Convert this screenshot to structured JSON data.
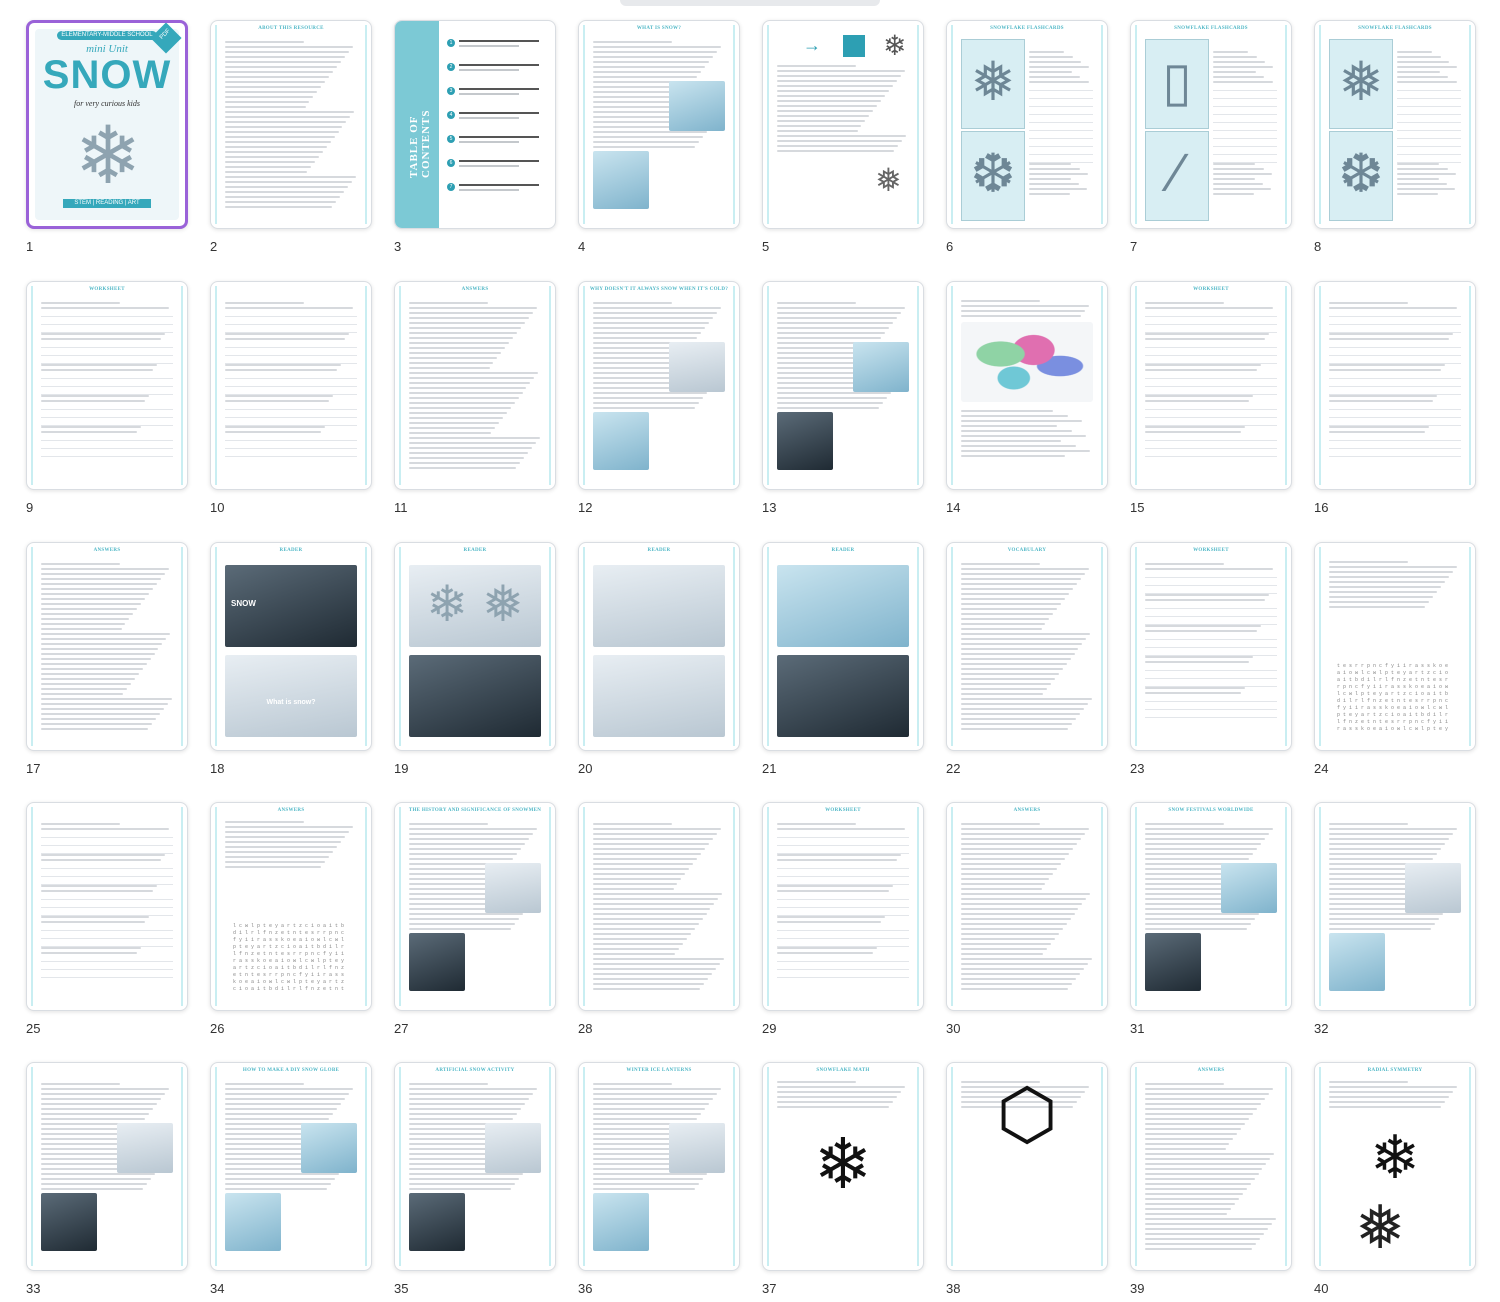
{
  "pages": [
    {
      "n": "1",
      "kind": "cover"
    },
    {
      "n": "2",
      "kind": "text",
      "title": "ABOUT THIS RESOURCE"
    },
    {
      "n": "3",
      "kind": "toc"
    },
    {
      "n": "4",
      "kind": "text-img",
      "title": "WHAT IS SNOW?"
    },
    {
      "n": "5",
      "kind": "diagram",
      "title": ""
    },
    {
      "n": "6",
      "kind": "flash",
      "title": "SNOWFLAKE FLASHCARDS"
    },
    {
      "n": "7",
      "kind": "flash",
      "title": "SNOWFLAKE FLASHCARDS"
    },
    {
      "n": "8",
      "kind": "flash",
      "title": "SNOWFLAKE FLASHCARDS"
    },
    {
      "n": "9",
      "kind": "worksheet",
      "title": "WORKSHEET"
    },
    {
      "n": "10",
      "kind": "worksheet",
      "title": ""
    },
    {
      "n": "11",
      "kind": "text",
      "title": "ANSWERS"
    },
    {
      "n": "12",
      "kind": "text-img",
      "title": "WHY DOESN'T IT ALWAYS SNOW WHEN IT'S COLD?"
    },
    {
      "n": "13",
      "kind": "text-img",
      "title": ""
    },
    {
      "n": "14",
      "kind": "map",
      "title": ""
    },
    {
      "n": "15",
      "kind": "worksheet",
      "title": "WORKSHEET"
    },
    {
      "n": "16",
      "kind": "worksheet",
      "title": ""
    },
    {
      "n": "17",
      "kind": "text",
      "title": "ANSWERS"
    },
    {
      "n": "18",
      "kind": "reader",
      "title": "READER"
    },
    {
      "n": "19",
      "kind": "reader",
      "title": "READER"
    },
    {
      "n": "20",
      "kind": "reader",
      "title": "READER"
    },
    {
      "n": "21",
      "kind": "reader",
      "title": "READER"
    },
    {
      "n": "22",
      "kind": "text",
      "title": "VOCABULARY"
    },
    {
      "n": "23",
      "kind": "worksheet",
      "title": "WORKSHEET"
    },
    {
      "n": "24",
      "kind": "wordsearch",
      "title": ""
    },
    {
      "n": "25",
      "kind": "worksheet",
      "title": ""
    },
    {
      "n": "26",
      "kind": "wordsearch",
      "title": "ANSWERS"
    },
    {
      "n": "27",
      "kind": "text-img",
      "title": "THE HISTORY AND SIGNIFICANCE OF SNOWMEN"
    },
    {
      "n": "28",
      "kind": "text",
      "title": ""
    },
    {
      "n": "29",
      "kind": "worksheet",
      "title": "WORKSHEET"
    },
    {
      "n": "30",
      "kind": "text",
      "title": "ANSWERS"
    },
    {
      "n": "31",
      "kind": "text-img",
      "title": "SNOW FESTIVALS WORLDWIDE"
    },
    {
      "n": "32",
      "kind": "text-img",
      "title": ""
    },
    {
      "n": "33",
      "kind": "text-img",
      "title": ""
    },
    {
      "n": "34",
      "kind": "text-img",
      "title": "HOW TO MAKE A DIY SNOW GLOBE"
    },
    {
      "n": "35",
      "kind": "text-img",
      "title": "ARTIFICIAL SNOW ACTIVITY"
    },
    {
      "n": "36",
      "kind": "text-img",
      "title": "WINTER ICE LANTERNS"
    },
    {
      "n": "37",
      "kind": "math",
      "title": "SNOWFLAKE MATH"
    },
    {
      "n": "38",
      "kind": "math",
      "title": ""
    },
    {
      "n": "39",
      "kind": "text",
      "title": "ANSWERS"
    },
    {
      "n": "40",
      "kind": "math",
      "title": "RADIAL SYMMETRY"
    }
  ],
  "cover": {
    "school": "ELEMENTARY-MIDDLE SCHOOL",
    "unit": "mini Unit",
    "title": "SNOW",
    "subtitle": "for very curious kids",
    "badge": "PDF",
    "footer": "STEM | READING | ART"
  },
  "toc": {
    "label": "TABLE OF CONTENTS",
    "numbers": [
      "1",
      "2",
      "3",
      "4",
      "5",
      "6",
      "7"
    ]
  },
  "reader": {
    "snow": "SNOW",
    "what": "What is snow?"
  },
  "selected_page": "1"
}
